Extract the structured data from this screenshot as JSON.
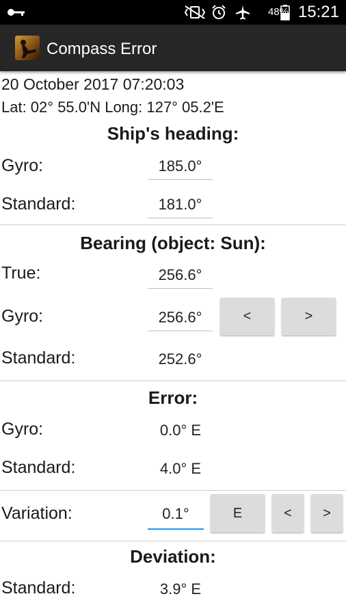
{
  "status_bar": {
    "battery": "48%",
    "time": "15:21",
    "icons": [
      "key-icon",
      "vibrate-mute-icon",
      "alarm-icon",
      "airplane-mode-icon",
      "battery-icon"
    ]
  },
  "app_bar": {
    "title": "Compass Error"
  },
  "info": {
    "datetime": "20 October 2017 07:20:03",
    "position": "Lat: 02° 55.0'N Long: 127° 05.2'E"
  },
  "heading": {
    "title": "Ship's heading:",
    "gyro_label": "Gyro:",
    "gyro_value": "185.0°",
    "standard_label": "Standard:",
    "standard_value": "181.0°"
  },
  "bearing": {
    "title": "Bearing (object: Sun):",
    "true_label": "True:",
    "true_value": "256.6°",
    "gyro_label": "Gyro:",
    "gyro_value": "256.6°",
    "dec_button": "<",
    "inc_button": ">",
    "standard_label": "Standard:",
    "standard_value": "252.6°"
  },
  "error": {
    "title": "Error:",
    "gyro_label": "Gyro:",
    "gyro_value": "0.0° E",
    "standard_label": "Standard:",
    "standard_value": "4.0° E"
  },
  "variation": {
    "label": "Variation:",
    "value": "0.1°",
    "direction_button": "E",
    "dec_button": "<",
    "inc_button": ">"
  },
  "deviation": {
    "title": "Deviation:",
    "standard_label": "Standard:",
    "standard_value": "3.9° E"
  }
}
